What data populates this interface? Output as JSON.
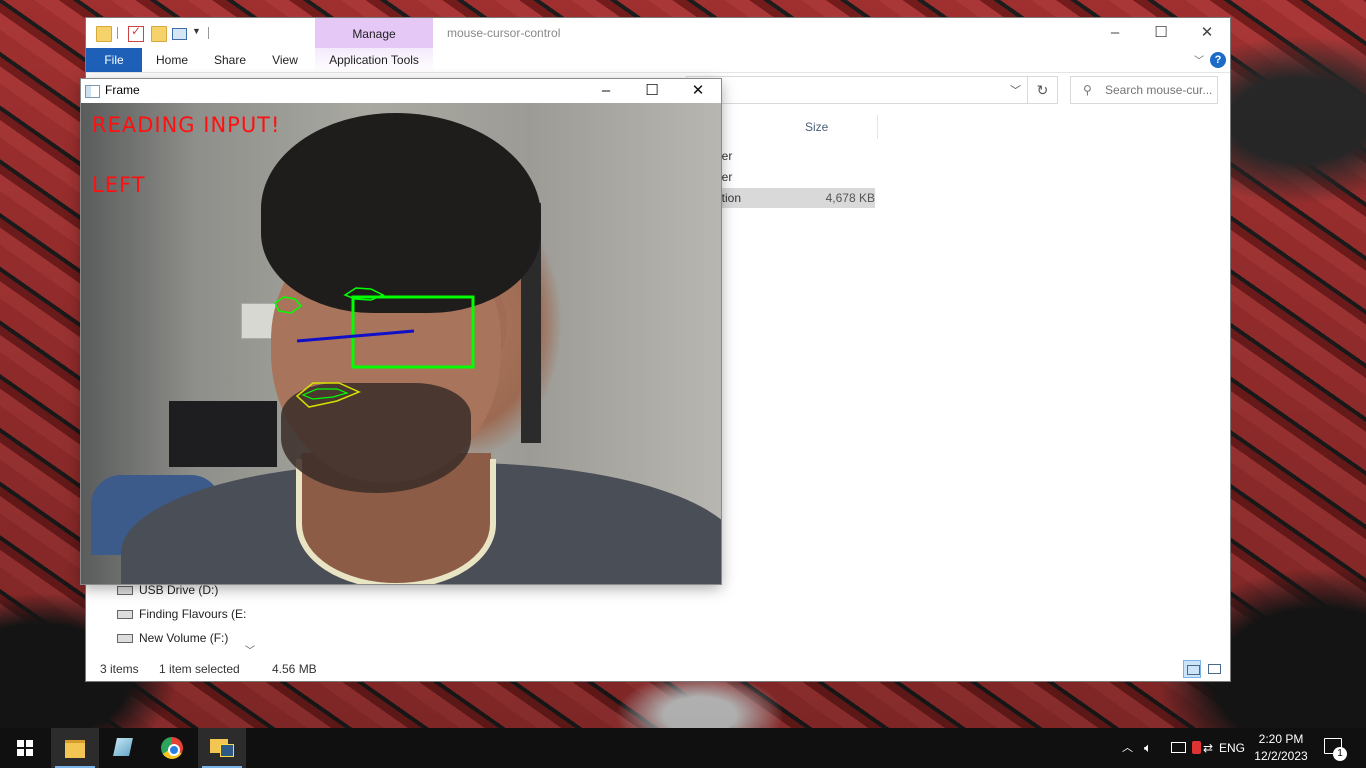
{
  "explorer": {
    "title": "mouse-cursor-control",
    "manage_tab": "Manage",
    "tabs": [
      "File",
      "Home",
      "Share",
      "View",
      "Application Tools"
    ],
    "search_placeholder": "Search mouse-cur...",
    "columns": {
      "size": "Size"
    },
    "rows": [
      {
        "type": "der",
        "size": ""
      },
      {
        "type": "der",
        "size": ""
      },
      {
        "type": "ation",
        "size": "4,678 KB",
        "selected": true
      }
    ],
    "nav_items": [
      "USB Drive (D:)",
      "Finding Flavours (E:",
      "New Volume (F:)"
    ],
    "status": {
      "items": "3 items",
      "selected": "1 item selected",
      "size": "4.56 MB"
    }
  },
  "frame": {
    "title": "Frame",
    "overlay": {
      "line1": "READING INPUT!",
      "line2": "LEFT"
    }
  },
  "taskbar": {
    "apps": [
      "start-icon",
      "file-explorer-icon",
      "notepad-icon",
      "chrome-icon",
      "python-icon"
    ],
    "tray": {
      "language": "ENG",
      "time": "2:20 PM",
      "date": "12/2/2023",
      "notifications": "1"
    }
  },
  "colors": {
    "file_tab": "#1e5fb8",
    "manage_tab": "#e6c8f7",
    "overlay_text": "#ff1010",
    "landmark_green": "#00ff00",
    "gaze_line": "#1010c8",
    "taskbar": "#101010"
  }
}
